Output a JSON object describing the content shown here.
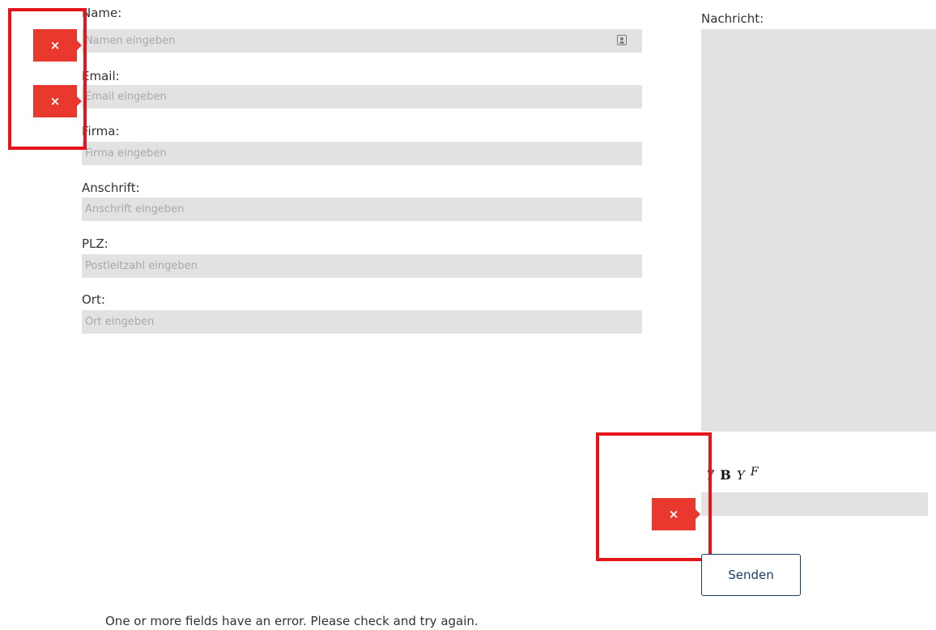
{
  "form": {
    "fields": [
      {
        "label": "Name:",
        "placeholder": "Namen eingeben"
      },
      {
        "label": "Email:",
        "placeholder": "Email eingeben"
      },
      {
        "label": "Firma:",
        "placeholder": "Firma eingeben"
      },
      {
        "label": "Anschrift:",
        "placeholder": "Anschrift eingeben"
      },
      {
        "label": "PLZ:",
        "placeholder": "Postleitzahl eingeben"
      },
      {
        "label": "Ort:",
        "placeholder": "Ort eingeben"
      }
    ],
    "message_label": "Nachricht:",
    "captcha": {
      "chars": [
        "7",
        "B",
        "Y",
        "F"
      ]
    },
    "submit_label": "Senden",
    "error_text": "One or more fields have an error. Please check and try again.",
    "error_badge_symbol": "×",
    "error_color": "#e9382d",
    "highlight_color": "#e5141a",
    "button_color": "#1c3e66"
  }
}
